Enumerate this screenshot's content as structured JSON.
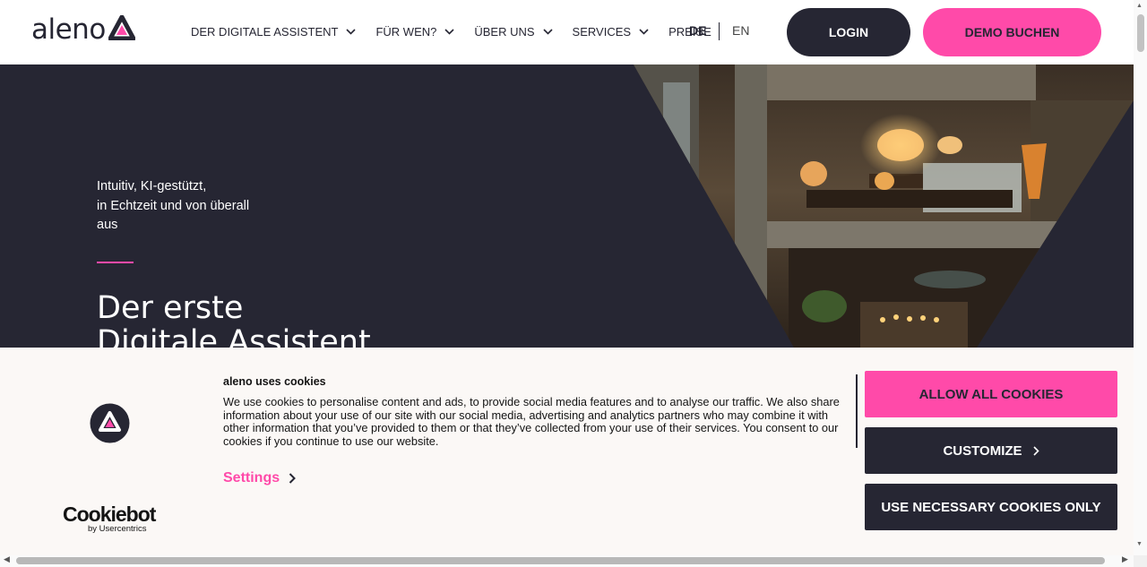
{
  "header": {
    "logo_text": "aleno",
    "nav": [
      {
        "label": "DER DIGITALE ASSISTENT",
        "has_dropdown": true
      },
      {
        "label": "FÜR WEN?",
        "has_dropdown": true
      },
      {
        "label": "ÜBER UNS",
        "has_dropdown": true
      },
      {
        "label": "SERVICES",
        "has_dropdown": true
      },
      {
        "label": "PREISE",
        "has_dropdown": false
      }
    ],
    "lang_de": "DE",
    "lang_en": "EN",
    "login_label": "LOGIN",
    "demo_label": "DEMO BUCHEN"
  },
  "hero": {
    "subtitle_lines": [
      "Intuitiv, KI-gestützt,",
      "in Echtzeit und von überall",
      "aus"
    ],
    "title_lines": [
      "Der erste",
      "Digitale Assistent"
    ]
  },
  "cookie_banner": {
    "brand_name": "Cookiebot",
    "brand_by": "by Usercentrics",
    "title": "aleno uses cookies",
    "text": "We use cookies to personalise content and ads, to provide social media features and to analyse our traffic. We also share information about your use of our site with our social media, advertising and analytics partners who may combine it with other information that you’ve provided to them or that they’ve collected from your use of their services. You consent to our cookies if you continue to use our website.",
    "settings_label": "Settings",
    "allow_all_label": "ALLOW ALL COOKIES",
    "customize_label": "CUSTOMIZE",
    "necessary_label": "USE NECESSARY COOKIES ONLY"
  },
  "colors": {
    "brand_dark": "#262633",
    "brand_pink": "#ff4aa9",
    "banner_bg": "#fbf8f6"
  },
  "icons": {
    "nav_dropdown": "chevron-down-icon",
    "settings": "chevron-right-icon",
    "customize": "chevron-right-icon",
    "logo_mark": "aleno-triangle-icon"
  }
}
